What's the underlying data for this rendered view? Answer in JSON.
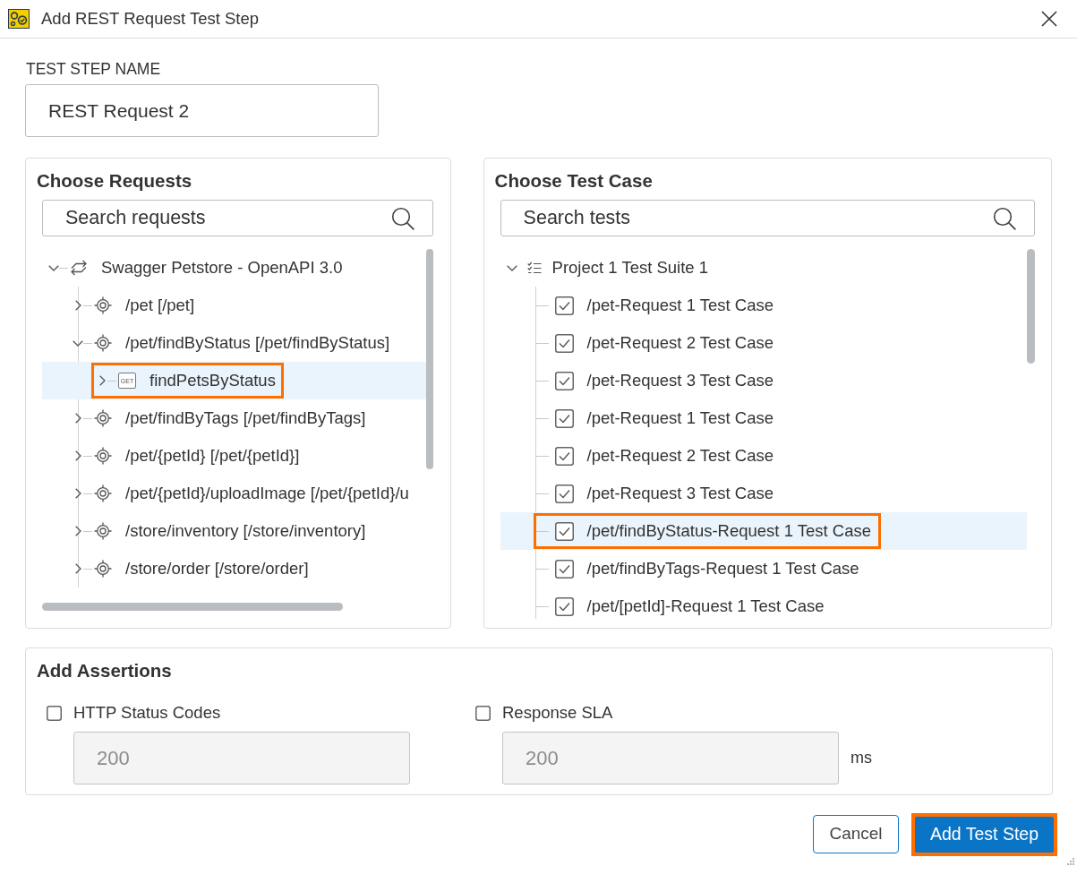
{
  "window": {
    "title": "Add REST Request Test Step"
  },
  "step_name": {
    "label": "TEST STEP NAME",
    "value": "REST Request 2"
  },
  "requests_panel": {
    "title": "Choose Requests",
    "search": {
      "placeholder": "Search requests"
    },
    "tree": [
      {
        "kind": "service",
        "label": "Swagger Petstore - OpenAPI 3.0",
        "expanded": true,
        "selected": false,
        "highlighted": false,
        "children": [
          {
            "kind": "resource",
            "label": "/pet [/pet]",
            "expanded": false,
            "selected": false,
            "highlighted": false
          },
          {
            "kind": "resource",
            "label": "/pet/findByStatus [/pet/findByStatus]",
            "expanded": true,
            "selected": false,
            "highlighted": false,
            "children": [
              {
                "kind": "method",
                "method": "GET",
                "label": "findPetsByStatus",
                "expanded": false,
                "selected": true,
                "highlighted": true
              }
            ]
          },
          {
            "kind": "resource",
            "label": "/pet/findByTags [/pet/findByTags]",
            "expanded": false,
            "selected": false,
            "highlighted": false
          },
          {
            "kind": "resource",
            "label": "/pet/{petId} [/pet/{petId}]",
            "expanded": false,
            "selected": false,
            "highlighted": false
          },
          {
            "kind": "resource",
            "label": "/pet/{petId}/uploadImage [/pet/{petId}/u",
            "expanded": false,
            "selected": false,
            "highlighted": false
          },
          {
            "kind": "resource",
            "label": "/store/inventory [/store/inventory]",
            "expanded": false,
            "selected": false,
            "highlighted": false
          },
          {
            "kind": "resource",
            "label": "/store/order [/store/order]",
            "expanded": false,
            "selected": false,
            "highlighted": false
          }
        ]
      }
    ]
  },
  "test_case_panel": {
    "title": "Choose Test Case",
    "search": {
      "placeholder": "Search tests"
    },
    "tree": [
      {
        "kind": "suite",
        "label": "Project 1 Test Suite 1",
        "expanded": true,
        "selected": false,
        "highlighted": false,
        "children": [
          {
            "kind": "test_case",
            "label": "/pet-Request 1 Test Case",
            "checked": true,
            "selected": false,
            "highlighted": false
          },
          {
            "kind": "test_case",
            "label": "/pet-Request 2 Test Case",
            "checked": true,
            "selected": false,
            "highlighted": false
          },
          {
            "kind": "test_case",
            "label": "/pet-Request 3 Test Case",
            "checked": true,
            "selected": false,
            "highlighted": false
          },
          {
            "kind": "test_case",
            "label": "/pet-Request 1 Test Case",
            "checked": true,
            "selected": false,
            "highlighted": false
          },
          {
            "kind": "test_case",
            "label": "/pet-Request 2 Test Case",
            "checked": true,
            "selected": false,
            "highlighted": false
          },
          {
            "kind": "test_case",
            "label": "/pet-Request 3 Test Case",
            "checked": true,
            "selected": false,
            "highlighted": false
          },
          {
            "kind": "test_case",
            "label": "/pet/findByStatus-Request 1 Test Case",
            "checked": true,
            "selected": true,
            "highlighted": true
          },
          {
            "kind": "test_case",
            "label": "/pet/findByTags-Request 1 Test Case",
            "checked": true,
            "selected": false,
            "highlighted": false
          },
          {
            "kind": "test_case",
            "label": "/pet/[petId]-Request 1 Test Case",
            "checked": true,
            "selected": false,
            "highlighted": false
          }
        ]
      }
    ]
  },
  "assertions": {
    "title": "Add Assertions",
    "items": [
      {
        "label": "HTTP Status Codes",
        "checked": false,
        "value": "200",
        "disabled": true
      },
      {
        "label": "Response SLA",
        "checked": false,
        "value": "200",
        "disabled": true,
        "unit": "ms"
      }
    ]
  },
  "buttons": [
    {
      "label": "Cancel",
      "kind": "secondary",
      "highlighted": false
    },
    {
      "label": "Add Test Step",
      "kind": "primary",
      "highlighted": true
    }
  ]
}
